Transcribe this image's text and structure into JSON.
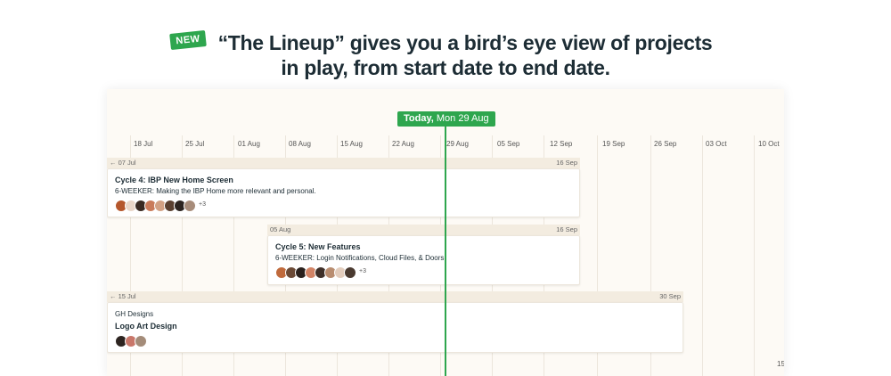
{
  "badge": {
    "label": "NEW"
  },
  "headline": {
    "line1": "“The Lineup” gives you a bird’s eye view of projects",
    "line2": "in play, from start date to end date."
  },
  "timeline": {
    "today": {
      "label": "Today,",
      "date": "Mon 29 Aug"
    },
    "dates": [
      "18 Jul",
      "25 Jul",
      "01 Aug",
      "08 Aug",
      "15 Aug",
      "22 Aug",
      "29 Aug",
      "05 Sep",
      "12 Sep",
      "19 Sep",
      "26 Sep",
      "03 Oct",
      "10 Oct"
    ],
    "edge_label": "15"
  },
  "cards": [
    {
      "range_start": "← 07 Jul",
      "range_end": "16 Sep",
      "group": "",
      "title": "Cycle 4: IBP New Home Screen",
      "description": "6-WEEKER: Making the IBP Home more relevant and personal.",
      "avatar_colors": [
        "#b5572c",
        "#e9d6c8",
        "#3a2a22",
        "#c97b5a",
        "#d2a184",
        "#5a4030",
        "#2c2420",
        "#a78c7a"
      ],
      "more": "+3"
    },
    {
      "range_start": "05 Aug",
      "range_end": "16 Sep",
      "group": "",
      "title": "Cycle 5: New Features",
      "description": "6-WEEKER: Login Notifications, Cloud Files, & Doors.",
      "avatar_colors": [
        "#c06a3c",
        "#6b4a36",
        "#2a211d",
        "#d28466",
        "#3f3029",
        "#b98d70",
        "#e3cdbd",
        "#4a3a30"
      ],
      "more": "+3"
    },
    {
      "range_start": "← 15 Jul",
      "range_end": "30 Sep",
      "group": "GH Designs",
      "title": "Logo Art Design",
      "description": "",
      "avatar_colors": [
        "#2d2420",
        "#c9776a",
        "#a48c79"
      ],
      "more": ""
    }
  ]
}
